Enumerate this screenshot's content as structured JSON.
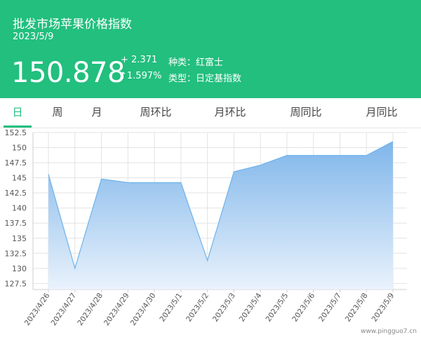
{
  "header": {
    "title": "批发市场苹果价格指数",
    "date": "2023/5/9",
    "price": "150.878",
    "change": "+ 2.371",
    "change_pct": "↑1.597%",
    "variety_label": "种类：红富士",
    "type_label": "类型：日定基指数"
  },
  "tabs": [
    "日",
    "周",
    "月",
    "周环比",
    "月环比",
    "周同比",
    "月同比"
  ],
  "active_tab": "日",
  "colors": {
    "header_bg": "#22bf7e",
    "accent": "#22bf7e",
    "line": "#6fb3ea",
    "fill_top": "#7fb6ea",
    "fill_bottom": "#e9f2fc"
  },
  "watermark": "www.pingguo7.cn",
  "chart_data": {
    "type": "area",
    "x": [
      "2023/4/26",
      "2023/4/27",
      "2023/4/28",
      "2023/4/29",
      "2023/4/30",
      "2023/5/1",
      "2023/5/2",
      "2023/5/3",
      "2023/5/4",
      "2023/5/5",
      "2023/5/6",
      "2023/5/7",
      "2023/5/8",
      "2023/5/9"
    ],
    "values": [
      145.6,
      130.0,
      144.8,
      144.2,
      144.2,
      144.2,
      131.3,
      146.0,
      147.1,
      148.7,
      148.7,
      148.7,
      148.7,
      151.0
    ],
    "ylim": [
      126.5,
      152.5
    ],
    "yticks": [
      127.5,
      130,
      132.5,
      135,
      137.5,
      140,
      142.5,
      145,
      147.5,
      150,
      152.5
    ],
    "ytick_labels": [
      "127.5",
      "130",
      "132.5",
      "135",
      "137.5",
      "140",
      "142.5",
      "145",
      "147.5",
      "150",
      "152.5"
    ],
    "grid": true,
    "legend": "none"
  }
}
